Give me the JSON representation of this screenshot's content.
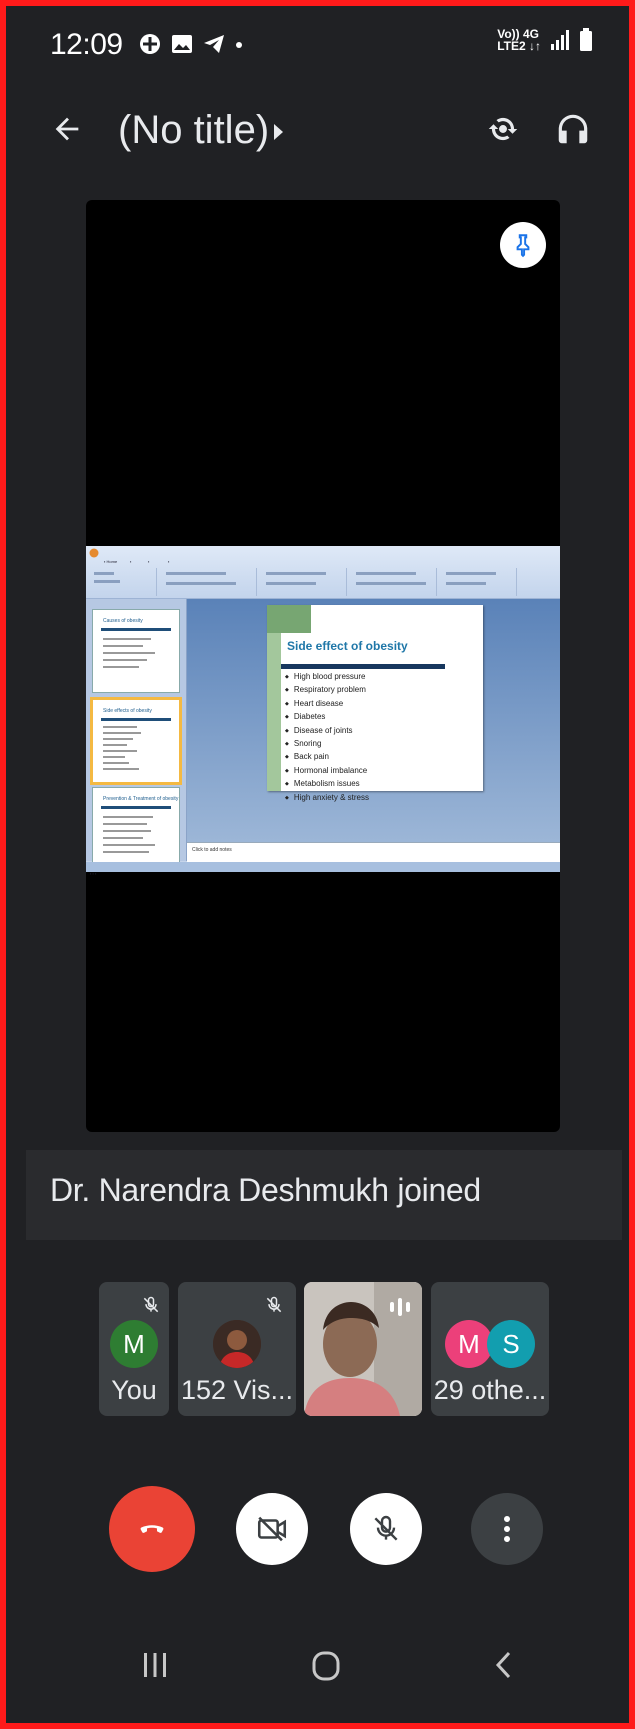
{
  "status_bar": {
    "time": "12:09",
    "network_top": "Vo)) 4G",
    "network_bottom": "LTE2 ↓↑"
  },
  "top_bar": {
    "title": "(No title)"
  },
  "presentation": {
    "slide_title": "Side effect of obesity",
    "bullets": [
      "High blood pressure",
      "Respiratory problem",
      "Heart disease",
      "Diabetes",
      "Disease of joints",
      "Snoring",
      "Back pain",
      "Hormonal imbalance",
      "Metabolism issues",
      "High anxiety & stress"
    ],
    "notes_placeholder": "Click to add notes",
    "thumb_titles": [
      "Causes of obesity",
      "Side effects of obesity",
      "Prevention & Treatment of obesity"
    ]
  },
  "notification": {
    "text": "Dr. Narendra Deshmukh joined"
  },
  "participants": {
    "you": {
      "initial": "M",
      "label": "You",
      "color": "#2e7d32"
    },
    "visitor": {
      "label": "152 Vis..."
    },
    "others": {
      "initial_a": "M",
      "initial_b": "S",
      "label": "29 othe...",
      "color_a": "#ec407a",
      "color_b": "#129eaf"
    }
  },
  "controls": {
    "end_color": "#ea4335"
  }
}
